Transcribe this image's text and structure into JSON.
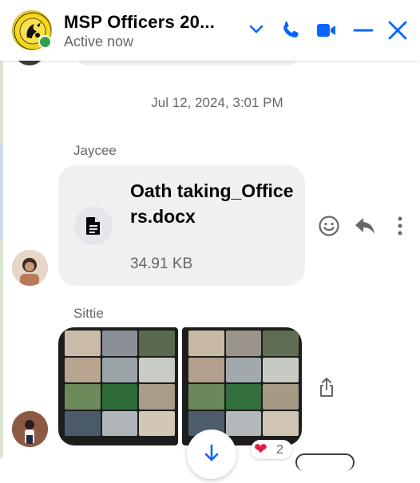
{
  "header": {
    "title": "MSP Officers 20...",
    "status": "Active now",
    "icons": [
      "chevron-down-icon",
      "phone-icon",
      "video-camera-icon",
      "minimize-icon",
      "close-icon"
    ],
    "accent_color": "#0866ff"
  },
  "conversation": {
    "timestamp": "Jul 12, 2024, 3:01 PM",
    "messages": [
      {
        "sender": "Jaycee",
        "type": "file",
        "file_name": "Oath taking_Officers.docx",
        "file_size": "34.91 KB",
        "actions": [
          "react-icon",
          "reply-icon",
          "more-icon"
        ]
      },
      {
        "sender": "Sittie",
        "type": "photos",
        "photo_count": 2,
        "actions": [
          "share-icon"
        ],
        "reaction": {
          "emoji": "❤",
          "count": "2"
        }
      }
    ]
  }
}
